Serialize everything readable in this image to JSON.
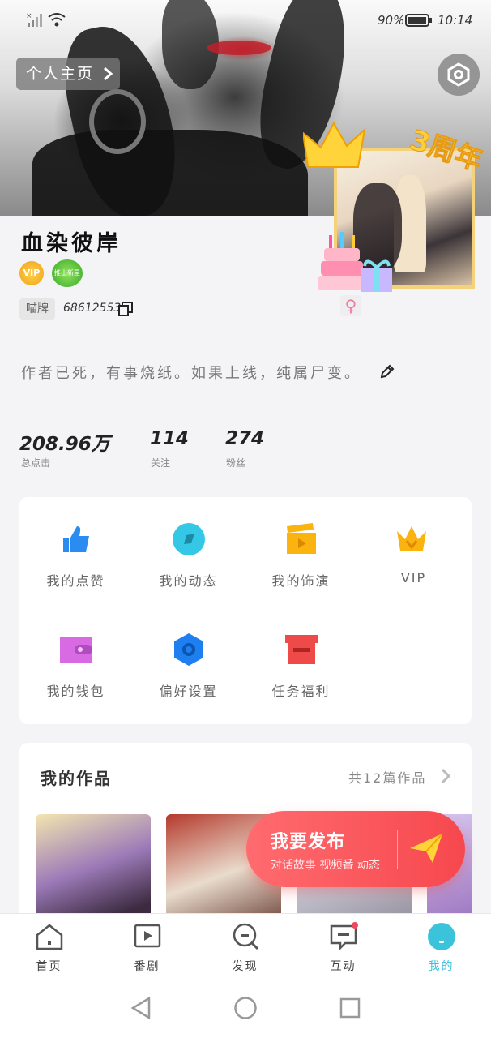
{
  "status_bar": {
    "battery": "90%",
    "time": "10:14"
  },
  "header": {
    "home_chip_label": "个人主页"
  },
  "profile": {
    "avatar_badge": "3周年",
    "name": "血染彼岸",
    "vip_label": "VIP",
    "honor_badge": "推出新星",
    "id_tag": "喵牌",
    "id_number": "68612553",
    "gender_symbol": "♀",
    "bio": "作者已死，有事烧纸。如果上线，纯属尸变。"
  },
  "stats": [
    {
      "value": "208.96万",
      "label": "总点击"
    },
    {
      "value": "114",
      "label": "关注"
    },
    {
      "value": "274",
      "label": "粉丝"
    }
  ],
  "services": [
    {
      "label": "我的点赞",
      "icon": "thumbs-up-icon",
      "color": "#2a8cf0"
    },
    {
      "label": "我的动态",
      "icon": "compass-icon",
      "color": "#35c8e6"
    },
    {
      "label": "我的饰演",
      "icon": "clapperboard-icon",
      "color": "#fbb40f"
    },
    {
      "label": "VIP",
      "icon": "crown-icon",
      "color": "#fbb40f"
    },
    {
      "label": "我的钱包",
      "icon": "wallet-icon",
      "color": "#d86be4"
    },
    {
      "label": "偏好设置",
      "icon": "hexagon-settings-icon",
      "color": "#1e7ff0"
    },
    {
      "label": "任务福利",
      "icon": "gift-box-icon",
      "color": "#ef4a4a"
    }
  ],
  "works": {
    "title": "我的作品",
    "count_label": "共12篇作品"
  },
  "publish": {
    "title": "我要发布",
    "subtitle": "对话故事 视频番 动态"
  },
  "tabs": [
    {
      "label": "首页",
      "icon": "home-icon"
    },
    {
      "label": "番剧",
      "icon": "play-icon"
    },
    {
      "label": "发现",
      "icon": "discover-icon"
    },
    {
      "label": "互动",
      "icon": "message-icon"
    },
    {
      "label": "我的",
      "icon": "profile-icon",
      "active": true
    }
  ],
  "accent_color": "#3bc3dc"
}
